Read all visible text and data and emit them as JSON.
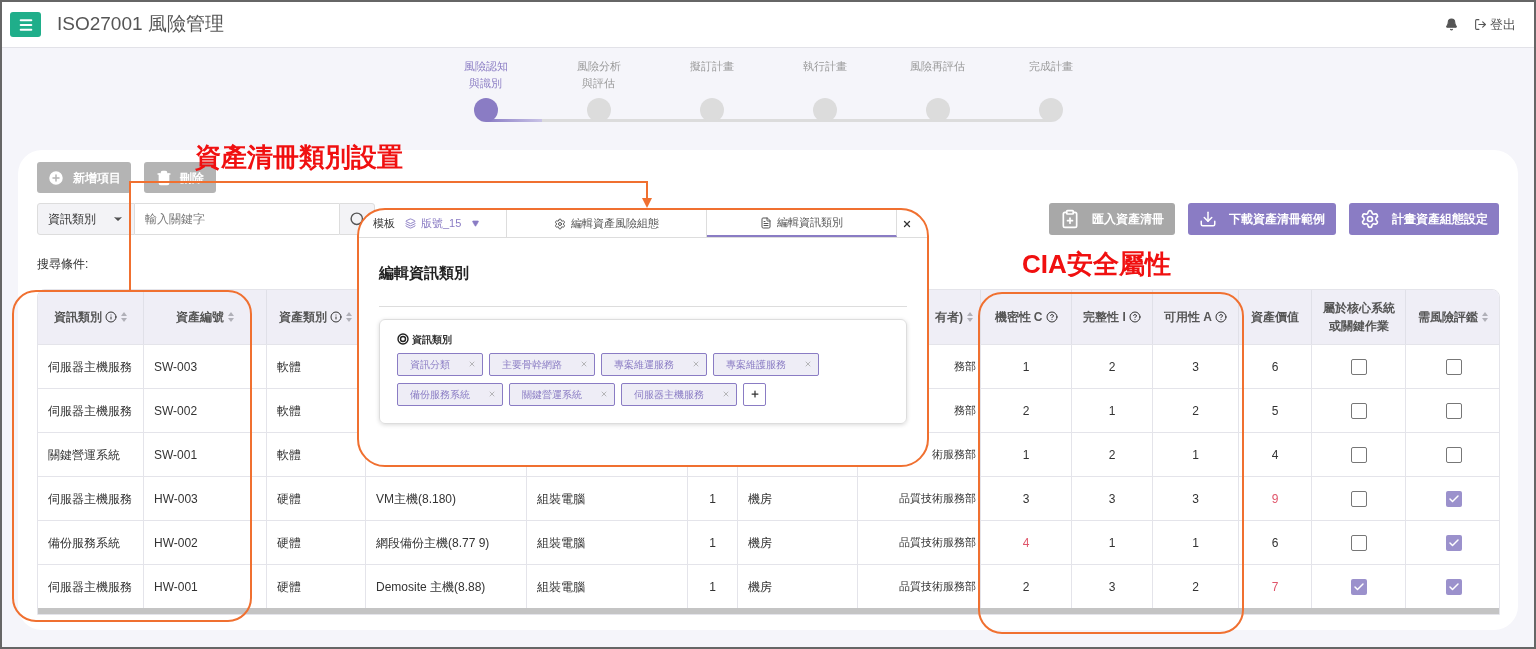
{
  "header": {
    "title": "ISO27001 風險管理",
    "logout": "登出"
  },
  "stepper": {
    "level": 0.5,
    "steps": [
      {
        "lines": [
          "風險認知",
          "與識別"
        ],
        "selected": true
      },
      {
        "lines": [
          "風險分析",
          "與評估"
        ],
        "selected": false
      },
      {
        "lines": [
          "擬訂計畫"
        ],
        "selected": false
      },
      {
        "lines": [
          "執行計畫"
        ],
        "selected": false
      },
      {
        "lines": [
          "風險再評估"
        ],
        "selected": false
      },
      {
        "lines": [
          "完成計畫"
        ],
        "selected": false
      }
    ]
  },
  "toolbar": {
    "add": {
      "label": "新增項目",
      "disabled": true
    },
    "delete": {
      "label": "刪除",
      "disabled": true
    },
    "filter": {
      "value": "資訊類別"
    },
    "search": {
      "placeholder": "輸入關鍵字"
    },
    "actions": [
      {
        "kind": "import",
        "label": "匯入資產清冊",
        "disabled": true
      },
      {
        "kind": "download",
        "label": "下載資產清冊範例",
        "disabled": false
      },
      {
        "kind": "settings",
        "label": "計畫資產組態設定",
        "disabled": false
      }
    ]
  },
  "search_conditions": "搜尋條件:",
  "table": {
    "columns": [
      {
        "label": "資訊類別",
        "sortable": true
      },
      {
        "label": "資產編號",
        "sortable": true
      },
      {
        "label": "資產類別",
        "sortable": true
      },
      {},
      {},
      {},
      {},
      {
        "label": "有者)",
        "sortable": true
      },
      {
        "label": "機密性 C"
      },
      {
        "label": "完整性 I"
      },
      {
        "label": "可用性 A"
      },
      {
        "label": "資產價值"
      },
      {
        "label": "屬於核心系統或關鍵作業"
      },
      {
        "label": "需風險評鑑",
        "sortable": true
      }
    ],
    "rows": [
      {
        "info_category": "伺服器主機服務",
        "asset_id": "SW-003",
        "asset_type": "軟體",
        "owner": "務部",
        "c": {
          "text": "1",
          "alert": false
        },
        "i": "2",
        "a": "3",
        "value": {
          "text": "6",
          "alert": false
        },
        "core": false,
        "assess": false
      },
      {
        "info_category": "伺服器主機服務",
        "asset_id": "SW-002",
        "asset_type": "軟體",
        "owner": "務部",
        "c": {
          "text": "2",
          "alert": false
        },
        "i": "1",
        "a": "2",
        "value": {
          "text": "5",
          "alert": false
        },
        "core": false,
        "assess": false
      },
      {
        "info_category": "關鍵營運系統",
        "asset_id": "SW-001",
        "asset_type": "軟體",
        "owner": "術服務部",
        "c": {
          "text": "1",
          "alert": false
        },
        "i": "2",
        "a": "1",
        "value": {
          "text": "4",
          "alert": false
        },
        "core": false,
        "assess": false
      },
      {
        "info_category": "伺服器主機服務",
        "asset_id": "HW-003",
        "asset_type": "硬體",
        "column_4": "VM主機(8.180)",
        "column_5": "組裝電腦",
        "column_6": "1",
        "column_7": "機房",
        "owner": "品質技術服務部",
        "c": {
          "text": "3",
          "alert": false
        },
        "i": "3",
        "a": "3",
        "value": {
          "text": "9",
          "alert": true
        },
        "core": false,
        "assess": true
      },
      {
        "info_category": "備份服務系統",
        "asset_id": "HW-002",
        "asset_type": "硬體",
        "column_4": "網段備份主機(8.77 9)",
        "column_5": "組裝電腦",
        "column_6": "1",
        "column_7": "機房",
        "owner": "品質技術服務部",
        "c": {
          "text": "4",
          "alert": true
        },
        "i": "1",
        "a": "1",
        "value": {
          "text": "6",
          "alert": false
        },
        "core": false,
        "assess": true
      },
      {
        "info_category": "伺服器主機服務",
        "asset_id": "HW-001",
        "asset_type": "硬體",
        "column_4": "Demosite 主機(8.88)",
        "column_5": "組裝電腦",
        "column_6": "1",
        "column_7": "機房",
        "owner": "品質技術服務部",
        "c": {
          "text": "2",
          "alert": false
        },
        "i": "3",
        "a": "2",
        "value": {
          "text": "7",
          "alert": true
        },
        "core": true,
        "assess": true
      }
    ]
  },
  "popup": {
    "template_label": "模板",
    "version": "版號_15",
    "tabs": [
      {
        "kind": "settings",
        "label": "編輯資產風險組態",
        "selected": false
      },
      {
        "kind": "document",
        "label": "編輯資訊類別",
        "selected": true
      }
    ],
    "heading": "編輯資訊類別",
    "field_label": "資訊類別",
    "tags": [
      "資訊分類",
      "主要骨幹網路",
      "專案維運服務",
      "專案維護服務",
      "備份服務系統",
      "關鍵營運系統",
      "伺服器主機服務"
    ]
  },
  "annotations": [
    {
      "text": "資產清冊類別設置"
    },
    {
      "text": "CIA安全屬性"
    }
  ]
}
